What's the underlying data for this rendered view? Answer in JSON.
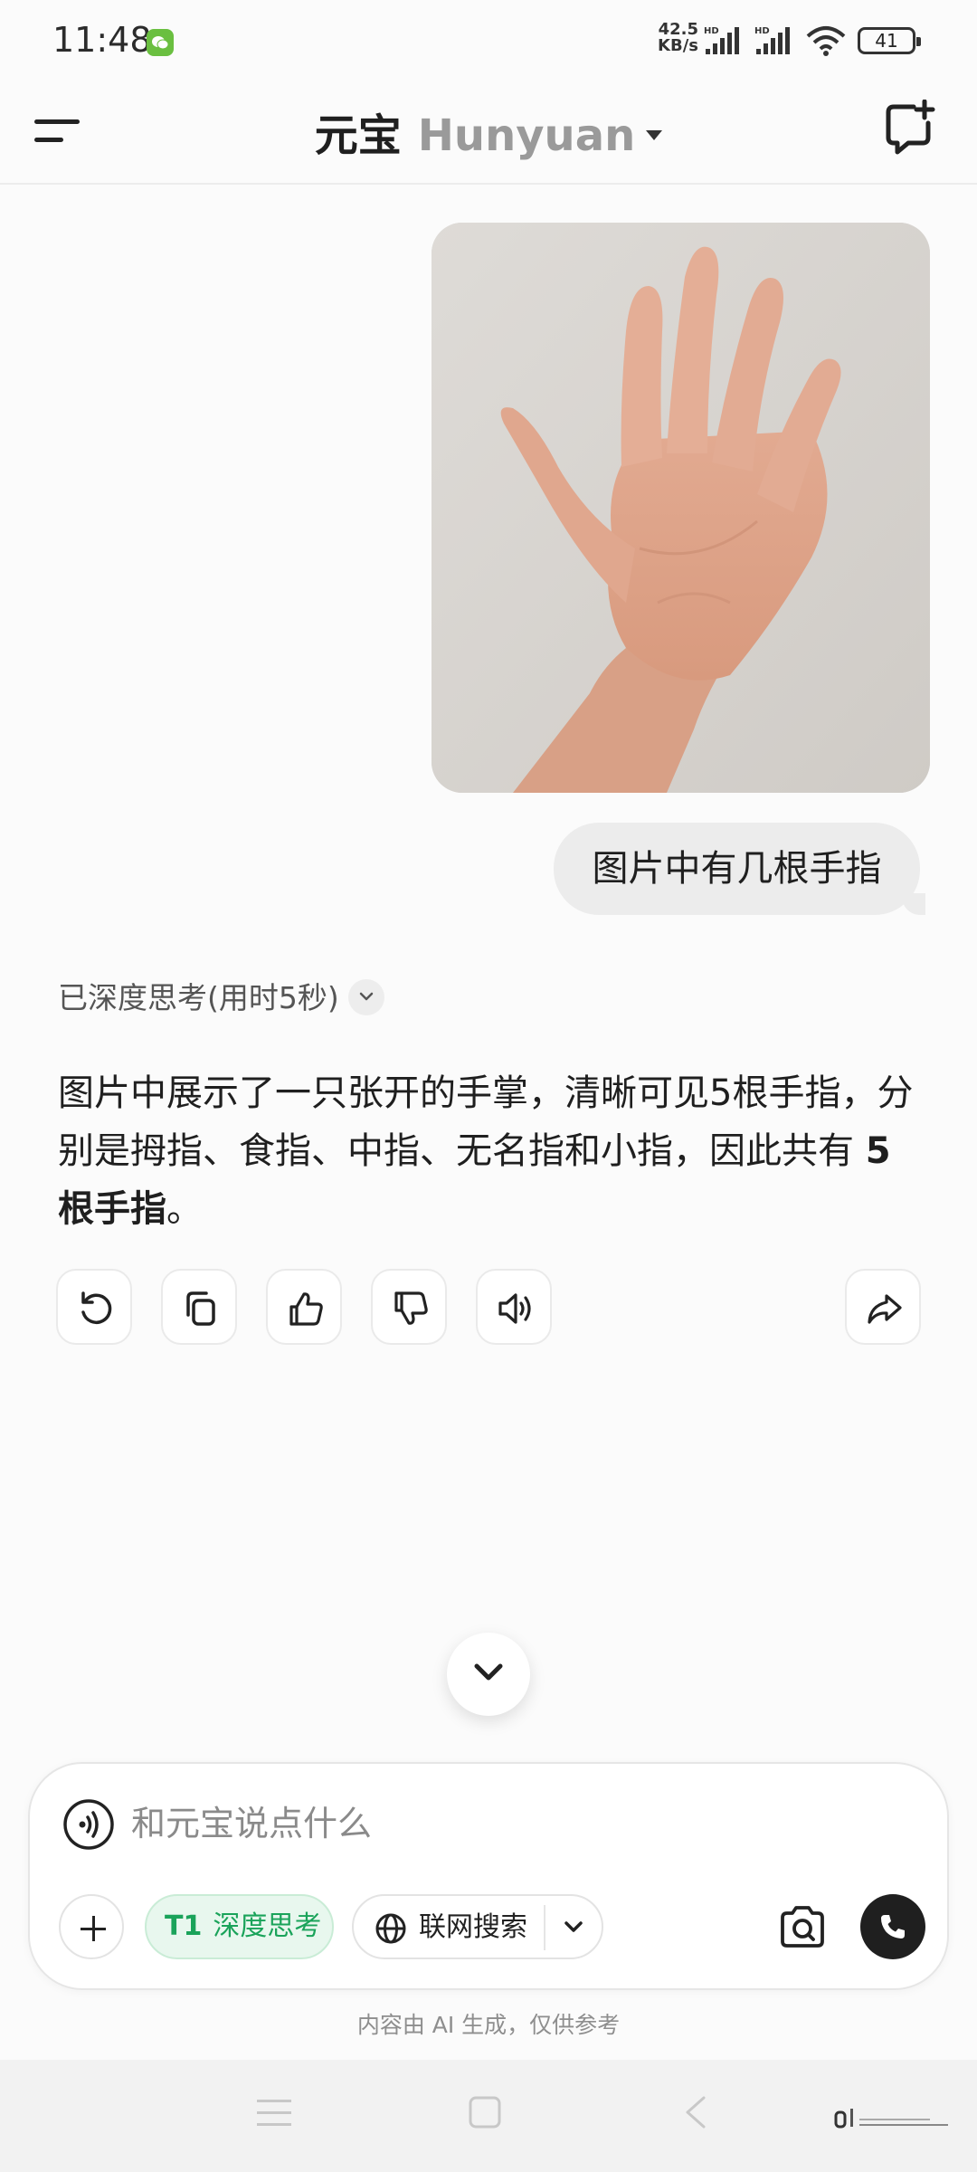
{
  "status_bar": {
    "time": "11:48",
    "net_speed_value": "42.5",
    "net_speed_unit": "KB/s",
    "battery": "41",
    "icons": [
      "wechat-icon",
      "signal-icon",
      "wifi-icon",
      "battery-icon"
    ]
  },
  "header": {
    "title": "元宝",
    "model": "Hunyuan",
    "icons": [
      "menu-icon",
      "new-chat-icon"
    ]
  },
  "chat": {
    "user_message": "图片中有几根手指",
    "thinking_label": "已深度思考(用时5秒)",
    "answer_text": "图片中展示了一只张开的手掌，清晰可见5根手指，分别是拇指、食指、中指、无名指和小指，因此共有 ",
    "answer_bold": "5根手指",
    "answer_end": "。"
  },
  "composer": {
    "placeholder": "和元宝说点什么",
    "deep_think_badge": "T1",
    "deep_think_label": "深度思考",
    "web_search_label": "联网搜索"
  },
  "disclaimer": "内容由 AI 生成，仅供参考",
  "colors": {
    "accent_green": "#1aa35a",
    "background": "#fbfbfb",
    "bubble": "#ececec"
  }
}
